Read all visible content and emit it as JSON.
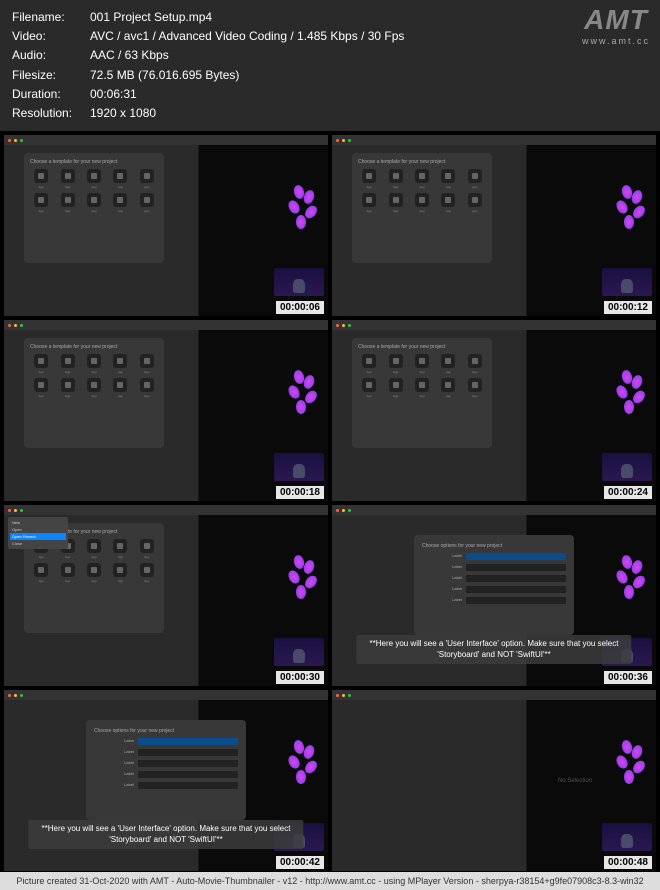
{
  "meta": {
    "filename_label": "Filename:",
    "filename": "001 Project Setup.mp4",
    "video_label": "Video:",
    "video": "AVC / avc1 / Advanced Video Coding / 1.485 Kbps / 30 Fps",
    "audio_label": "Audio:",
    "audio": "AAC / 63 Kbps",
    "filesize_label": "Filesize:",
    "filesize": "72.5 MB (76.016.695 Bytes)",
    "duration_label": "Duration:",
    "duration": "00:06:31",
    "resolution_label": "Resolution:",
    "resolution": "1920 x 1080"
  },
  "logo": {
    "main": "AMT",
    "sub": "www.amt.cc"
  },
  "thumbnails": [
    {
      "timestamp": "00:00:06",
      "type": "template-grid"
    },
    {
      "timestamp": "00:00:12",
      "type": "template-grid"
    },
    {
      "timestamp": "00:00:18",
      "type": "template-grid"
    },
    {
      "timestamp": "00:00:24",
      "type": "template-grid"
    },
    {
      "timestamp": "00:00:30",
      "type": "menu-open"
    },
    {
      "timestamp": "00:00:36",
      "type": "options",
      "caption": "**Here you will see a 'User Interface' option. Make sure that you select 'Storyboard' and NOT 'SwiftUI'**"
    },
    {
      "timestamp": "00:00:42",
      "type": "options",
      "caption": "**Here you will see a 'User Interface' option. Make sure that you select 'Storyboard' and NOT 'SwiftUI'**"
    },
    {
      "timestamp": "00:00:48",
      "type": "empty"
    }
  ],
  "dialog": {
    "template_title": "Choose a template for your new project",
    "options_title": "Choose options for your new project",
    "empty_text": "No Selection"
  },
  "footer": "Picture created 31-Oct-2020 with AMT - Auto-Movie-Thumbnailer - v12 - http://www.amt.cc - using MPlayer Version - sherpya-r38154+g9fe07908c3-8.3-win32"
}
